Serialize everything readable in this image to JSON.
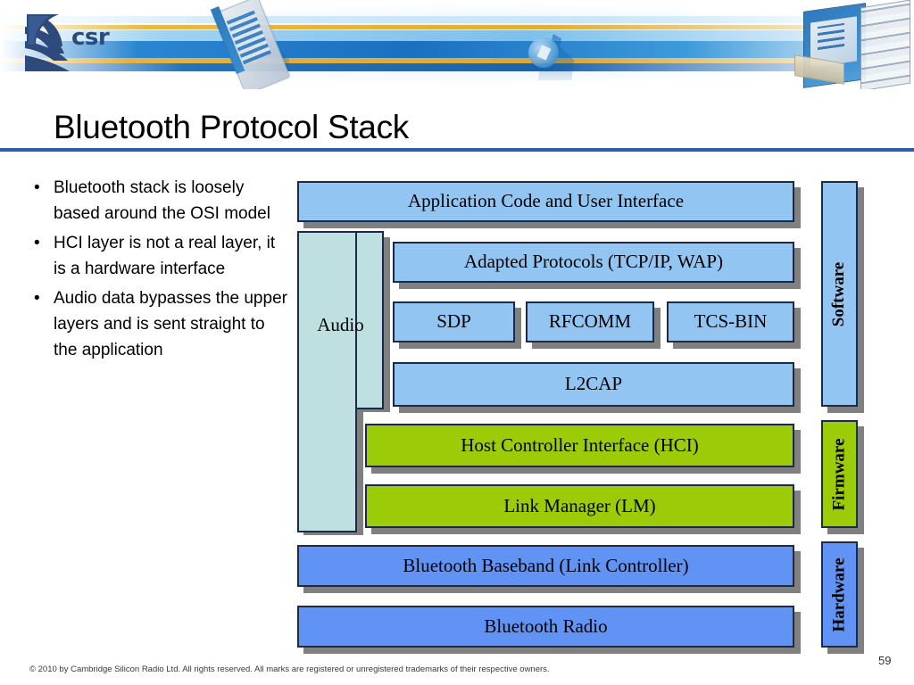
{
  "slide": {
    "title": "Bluetooth Protocol Stack",
    "number": "59",
    "footer": "© 2010 by Cambridge Silicon Radio Ltd. All rights reserved. All marks are registered or unregistered trademarks of their respective owners.",
    "logo_text": "csr"
  },
  "bullets": [
    {
      "marker": "•",
      "text": "Bluetooth stack is loosely based around the OSI model"
    },
    {
      "marker": "•",
      "text": "HCI layer is not a real layer, it is a hardware interface"
    },
    {
      "marker": "•",
      "text": "Audio data bypasses the upper layers and is sent straight to the application"
    }
  ],
  "diagram": {
    "audio": "Audio",
    "layers": [
      {
        "label": "Application Code and User Interface",
        "color": "#93c5f2",
        "tier": "software"
      },
      {
        "label": "Adapted Protocols (TCP/IP, WAP)",
        "color": "#93c5f2",
        "tier": "software"
      },
      {
        "label": "SDP",
        "color": "#93c5f2",
        "tier": "software"
      },
      {
        "label": "RFCOMM",
        "color": "#93c5f2",
        "tier": "software"
      },
      {
        "label": "TCS-BIN",
        "color": "#93c5f2",
        "tier": "software"
      },
      {
        "label": "L2CAP",
        "color": "#93c5f2",
        "tier": "software"
      },
      {
        "label": "Host Controller Interface (HCI)",
        "color": "#9ccc08",
        "tier": "firmware"
      },
      {
        "label": "Link Manager (LM)",
        "color": "#9ccc08",
        "tier": "firmware"
      },
      {
        "label": "Bluetooth Baseband (Link Controller)",
        "color": "#6193f5",
        "tier": "hardware"
      },
      {
        "label": "Bluetooth Radio",
        "color": "#6193f5",
        "tier": "hardware"
      }
    ],
    "tiers": [
      {
        "label": "Software",
        "color": "#93c5f2"
      },
      {
        "label": "Firmware",
        "color": "#9ccc08"
      },
      {
        "label": "Hardware",
        "color": "#6193f5"
      }
    ]
  },
  "colors": {
    "accent_rule": "#2a5ca8",
    "logo_navy": "#2e4a7d",
    "box_border": "#1b2a4a",
    "shadow": "#808080",
    "audio_fill": "#bfe0e0"
  }
}
